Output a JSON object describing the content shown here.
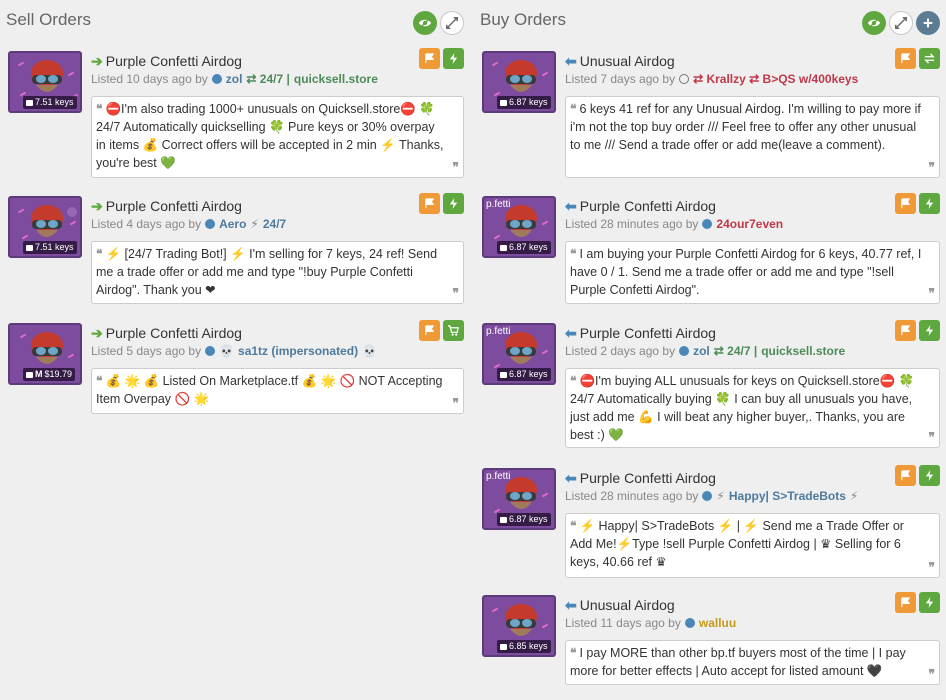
{
  "sell": {
    "title": "Sell Orders",
    "listings": [
      {
        "item_name": "Purple Confetti Airdog",
        "price": "7.51 keys",
        "listed_prefix": "Listed 10 days ago by",
        "user_parts": [
          "zol",
          "⇄ 24/7 |",
          "quicksell.store"
        ],
        "message": "⛔I'm also trading 1000+ unusuals on Quicksell.store⛔ 🍀 24/7 Automatically quickselling 🍀 Pure keys or 30% overpay in items 💰 Correct offers will be accepted in 2 min ⚡ Thanks, you're best 💚",
        "action_icons": [
          "flag-icon",
          "lightning-icon"
        ]
      },
      {
        "item_name": "Purple Confetti Airdog",
        "price": "7.51 keys",
        "listed_prefix": "Listed 4 days ago by",
        "user_parts": [
          "Aero",
          "⚡",
          "24/7"
        ],
        "message": "⚡ [24/7 Trading Bot!] ⚡ I'm selling for 7 keys, 24 ref! Send me a trade offer or add me and type \"!buy Purple Confetti Airdog\". Thank you ❤",
        "action_icons": [
          "flag-icon",
          "lightning-icon"
        ]
      },
      {
        "item_name": "Purple Confetti Airdog",
        "price": "$19.79",
        "price_prefix": "M",
        "listed_prefix": "Listed 5 days ago by",
        "user_parts": [
          "💀",
          "sa1tz (impersonated)",
          "💀"
        ],
        "message": "💰 🌟 💰 Listed On Marketplace.tf 💰 🌟 🚫 NOT Accepting Item Overpay 🚫 🌟",
        "action_icons": [
          "flag-icon",
          "cart-icon"
        ]
      }
    ]
  },
  "buy": {
    "title": "Buy Orders",
    "listings": [
      {
        "item_name": "Unusual Airdog",
        "price": "6.87 keys",
        "listed_prefix": "Listed 7 days ago by",
        "user_parts": [
          "⇄ Krallzy ⇄ B>QS w/400keys"
        ],
        "message": "6 keys 41 ref for any Unusual Airdog. I'm willing to pay more if i'm not the top buy order /// Feel free to offer any other unusual to me /// Send a trade offer or add me(leave a comment).",
        "action_icons": [
          "flag-icon",
          "swap-icon"
        ]
      },
      {
        "item_name": "Purple Confetti Airdog",
        "price": "6.87 keys",
        "tile_label": "p.fetti",
        "listed_prefix": "Listed 28 minutes ago by",
        "user_parts": [
          "24our7even"
        ],
        "message": "I am buying your Purple Confetti Airdog for 6 keys, 40.77 ref, I have 0 / 1. Send me a trade offer or add me and type \"!sell Purple Confetti Airdog\".",
        "action_icons": [
          "flag-icon",
          "lightning-icon"
        ]
      },
      {
        "item_name": "Purple Confetti Airdog",
        "price": "6.87 keys",
        "tile_label": "p.fetti",
        "listed_prefix": "Listed 2 days ago by",
        "user_parts": [
          "zol",
          "⇄ 24/7 |",
          "quicksell.store"
        ],
        "message": "⛔I'm buying ALL unusuals for keys on Quicksell.store⛔ 🍀 24/7 Automatically buying 🍀 I can buy all unusuals you have, just add me 💪 I will beat any higher buyer,. Thanks, you are best :) 💚",
        "action_icons": [
          "flag-icon",
          "lightning-icon"
        ]
      },
      {
        "item_name": "Purple Confetti Airdog",
        "price": "6.87 keys",
        "tile_label": "p.fetti",
        "listed_prefix": "Listed 28 minutes ago by",
        "user_parts": [
          "⚡",
          "Happy| S>TradeBots",
          "⚡"
        ],
        "message": "⚡ Happy| S>TradeBots ⚡ | ⚡ Send me a Trade Offer or Add Me!⚡Type !sell Purple Confetti Airdog | ♛ Selling for 6 keys, 40.66 ref ♛",
        "action_icons": [
          "flag-icon",
          "lightning-icon"
        ]
      },
      {
        "item_name": "Unusual Airdog",
        "price": "6.85 keys",
        "listed_prefix": "Listed 11 days ago by",
        "user_parts": [
          "walluu"
        ],
        "message": "I pay MORE than other bp.tf buyers most of the time | I pay more for better effects | Auto accept for listed amount 🖤",
        "action_icons": [
          "flag-icon",
          "lightning-icon"
        ]
      }
    ]
  },
  "colors": {
    "action_orange": "#ef9a36",
    "action_green": "#5fa840",
    "tile_purple": "#7d4c9e",
    "buy_arrow": "#4a87b8",
    "sell_arrow": "#5fa840"
  }
}
